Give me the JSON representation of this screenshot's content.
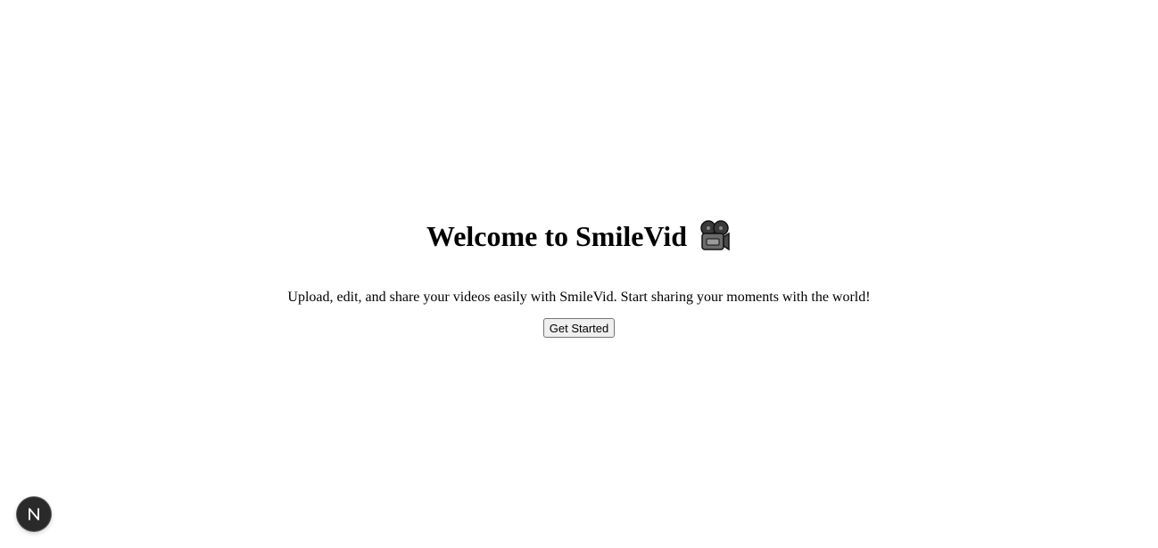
{
  "hero": {
    "title": "Welcome to SmileVid",
    "title_icon": "movie-camera-icon",
    "subtitle": "Upload, edit, and share your videos easily with SmileVid. Start sharing your moments with the world!",
    "cta_label": "Get Started"
  },
  "dev_indicator": {
    "icon": "nextjs-logo-icon",
    "letter": "N",
    "bg_color": "#2a2a2a"
  }
}
